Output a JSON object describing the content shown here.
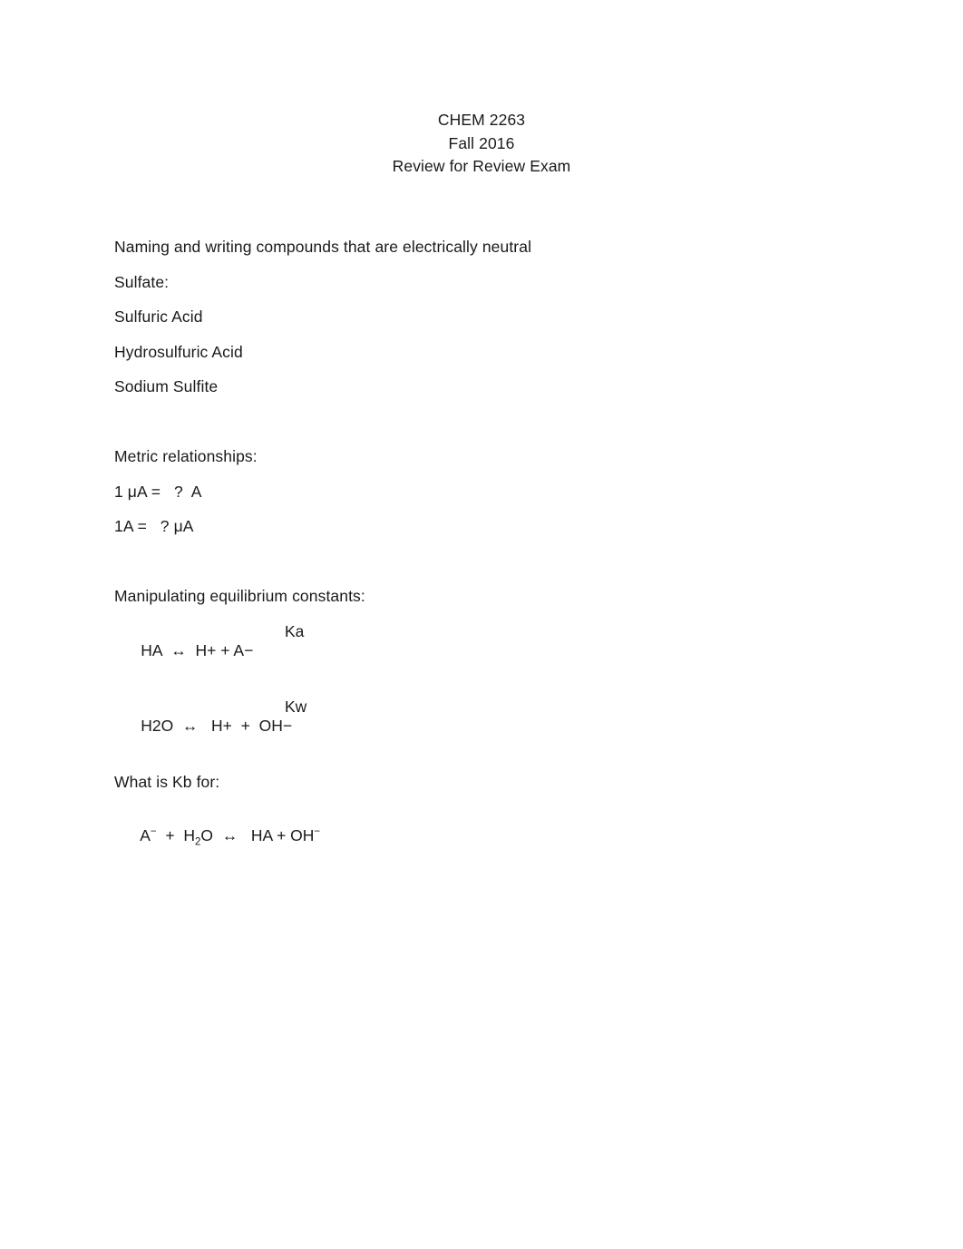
{
  "document": {
    "title_block": {
      "line1": "CHEM 2263",
      "line2": "Fall 2016",
      "line3": "Review for Review Exam"
    },
    "sections": {
      "naming": {
        "heading": "Naming and writing compounds that are electrically neutral",
        "item1": "Sulfate:",
        "item2": "Sulfuric Acid",
        "item3": "Hydrosulfuric Acid",
        "item4": "Sodium Sulfite"
      },
      "metric": {
        "heading": "Metric relationships:",
        "line1": "1 μA =   ?  A",
        "line2": "1A =   ? μA"
      },
      "equilibrium": {
        "heading": "Manipulating equilibrium constants:",
        "eq1": {
          "reactant": "HA",
          "arrow": "↔",
          "products_a": "H",
          "products_a_charge": "+",
          "plus": "+",
          "products_b": "A",
          "products_b_charge": "−",
          "constant": "Ka"
        },
        "eq2": {
          "reactant": "H",
          "reactant_sub": "2",
          "reactant_rest": "O",
          "arrow": "↔",
          "products_a": "H",
          "products_a_charge": "+",
          "plus": "+",
          "products_b": "OH",
          "products_b_charge": "−",
          "constant": "Kw"
        },
        "question": "What is Kb for:",
        "eq3": {
          "reactant_a": "A",
          "reactant_a_charge": "−",
          "plus1": "+",
          "reactant_b": "H",
          "reactant_b_sub": "2",
          "reactant_b_rest": "O",
          "arrow": "↔",
          "product_a": "HA",
          "plus2": "+",
          "product_b": "OH",
          "product_b_charge": "−"
        }
      }
    }
  }
}
